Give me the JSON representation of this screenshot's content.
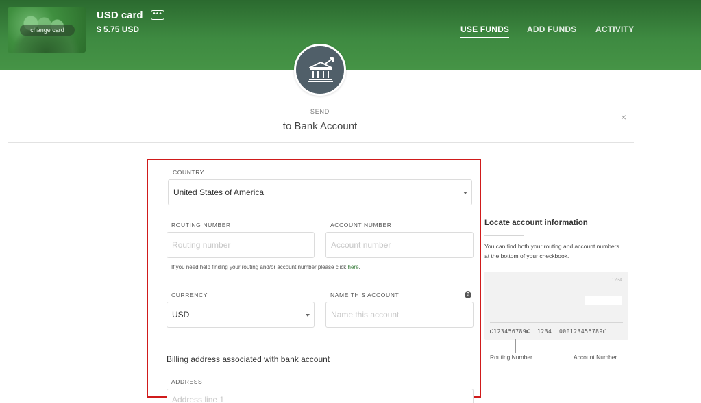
{
  "header": {
    "card_name": "USD card",
    "card_balance": "$ 5.75 USD",
    "change_card_label": "change card",
    "more_label": "•••",
    "nav": [
      "USE FUNDS",
      "ADD FUNDS",
      "ACTIVITY"
    ],
    "active_nav": "USE FUNDS"
  },
  "page": {
    "send_label": "SEND",
    "title": "to Bank Account",
    "close_glyph": "×",
    "bank_icon": "bank-transfer-icon"
  },
  "form": {
    "country_label": "COUNTRY",
    "country_value": "United States of America",
    "routing_label": "ROUTING NUMBER",
    "routing_placeholder": "Routing number",
    "account_label": "ACCOUNT NUMBER",
    "account_placeholder": "Account number",
    "help_text": "If you need help finding your routing and/or account number please click ",
    "help_link": "here",
    "help_end": ".",
    "currency_label": "CURRENCY",
    "currency_value": "USD",
    "name_label": "NAME THIS ACCOUNT",
    "name_placeholder": "Name this account",
    "help_icon_glyph": "?",
    "billing_heading": "Billing address associated with bank account",
    "address_label": "ADDRESS",
    "address_placeholder": "Address line 1"
  },
  "info": {
    "title": "Locate account information",
    "text": "You can find both your routing and account numbers at the bottom of your checkbook.",
    "check_number": "1234",
    "micr": "⑆123456789⑆  1234  000123456789⑈",
    "routing_caption": "Routing Number",
    "account_caption": "Account Number"
  },
  "colors": {
    "header_green": "#3e8a41",
    "highlight_red": "#d01b1b",
    "icon_circle": "#505f69",
    "link_green": "#3a7d3d"
  }
}
